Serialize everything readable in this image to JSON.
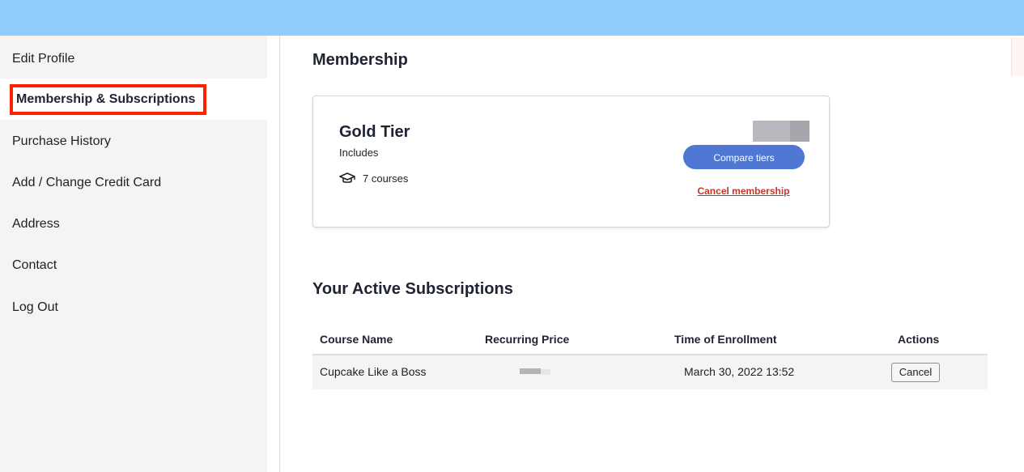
{
  "sidebar": {
    "items": [
      {
        "label": "Edit Profile"
      },
      {
        "label": "Membership & Subscriptions",
        "active": true
      },
      {
        "label": "Purchase History"
      },
      {
        "label": "Add / Change Credit Card"
      },
      {
        "label": "Address"
      },
      {
        "label": "Contact"
      },
      {
        "label": "Log Out"
      }
    ]
  },
  "membership": {
    "heading": "Membership",
    "tier_name": "Gold Tier",
    "includes_label": "Includes",
    "courses_text": "7 courses",
    "courses_icon": "graduation-cap-icon",
    "compare_label": "Compare tiers",
    "cancel_label": "Cancel membership"
  },
  "subscriptions": {
    "heading": "Your Active Subscriptions",
    "columns": [
      "Course Name",
      "Recurring Price",
      "Time of Enrollment",
      "Actions"
    ],
    "rows": [
      {
        "course": "Cupcake Like a Boss",
        "time": "March 30, 2022 13:52",
        "action": "Cancel"
      }
    ]
  },
  "colors": {
    "topbar": "#90cdfc",
    "primary_button": "#4f78d4",
    "cancel_link": "#c0392b",
    "highlight_border": "#ff2200"
  }
}
